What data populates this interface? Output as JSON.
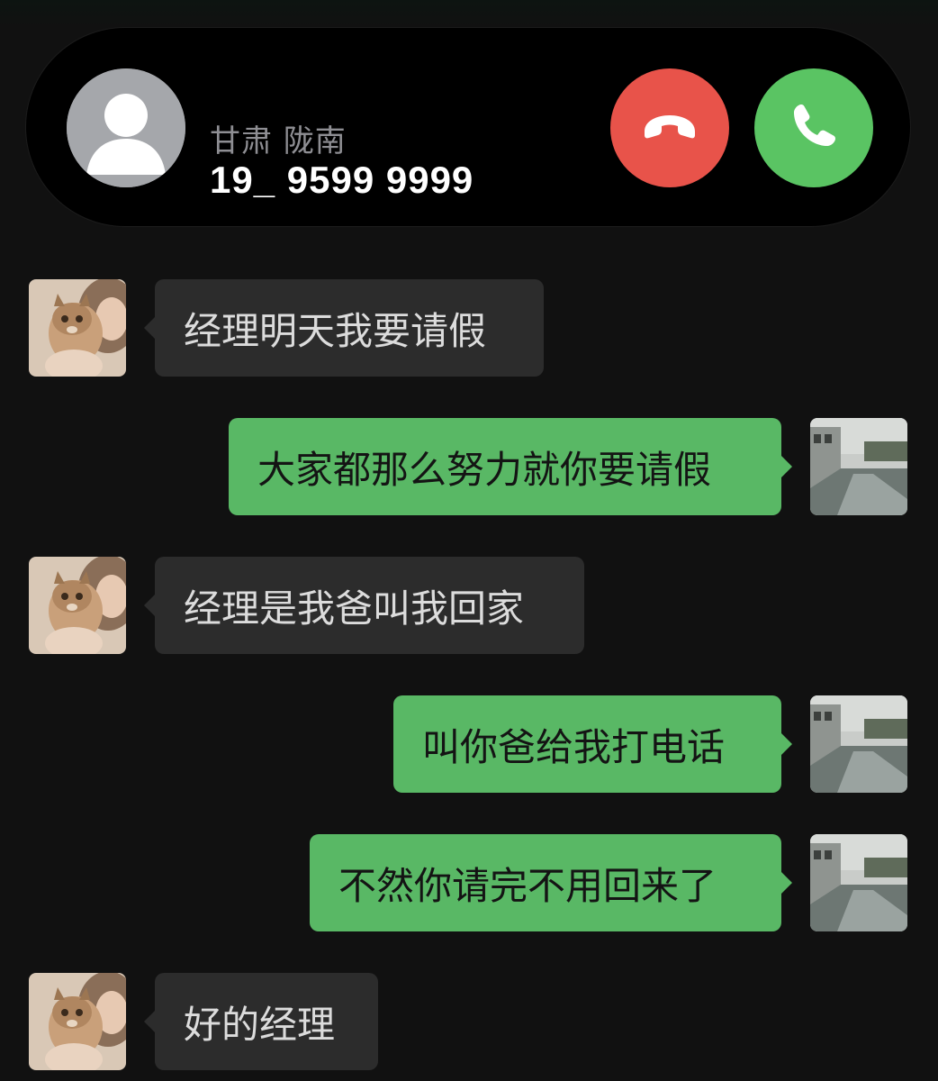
{
  "incoming_call": {
    "location": "甘肃 陇南",
    "number": "19_ 9599 9999",
    "decline_icon": "phone-hangup-icon",
    "accept_icon": "phone-icon",
    "colors": {
      "decline": "#e8534a",
      "accept": "#5ac463"
    }
  },
  "chat": {
    "messages": [
      {
        "side": "left",
        "sender": "other",
        "text": "经理明天我要请假"
      },
      {
        "side": "right",
        "sender": "self",
        "text": "大家都那么努力就你要请假"
      },
      {
        "side": "left",
        "sender": "other",
        "text": "经理是我爸叫我回家"
      },
      {
        "side": "right",
        "sender": "self",
        "text": "叫你爸给我打电话"
      },
      {
        "side": "right",
        "sender": "self",
        "text": "不然你请完不用回来了"
      },
      {
        "side": "left",
        "sender": "other",
        "text": "好的经理"
      }
    ],
    "colors": {
      "incoming_bubble": "#2c2c2c",
      "outgoing_bubble": "#59b865"
    }
  }
}
